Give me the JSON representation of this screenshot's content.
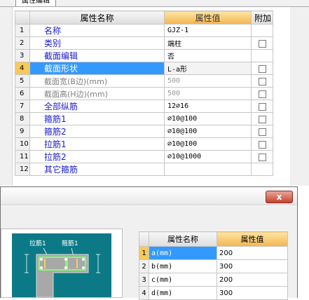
{
  "panel": {
    "tab_label": "属性编辑",
    "headers": {
      "name": "属性名称",
      "value": "属性值",
      "extra": "附加"
    },
    "rows": [
      {
        "num": "1",
        "name": "名称",
        "value": "GJZ-1",
        "checkbox": false,
        "dim": false,
        "selected": false
      },
      {
        "num": "2",
        "name": "类别",
        "value": "端柱",
        "checkbox": true,
        "dim": false,
        "selected": false
      },
      {
        "num": "3",
        "name": "截面编辑",
        "value": "否",
        "checkbox": false,
        "dim": false,
        "selected": false
      },
      {
        "num": "4",
        "name": "截面形状",
        "value": "L-a形",
        "checkbox": true,
        "dim": false,
        "selected": true
      },
      {
        "num": "5",
        "name": "截面宽(B边)(mm)",
        "value": "500",
        "checkbox": true,
        "dim": true,
        "selected": false
      },
      {
        "num": "6",
        "name": "截面高(H边)(mm)",
        "value": "500",
        "checkbox": true,
        "dim": true,
        "selected": false
      },
      {
        "num": "7",
        "name": "全部纵筋",
        "value": "12⌀16",
        "checkbox": true,
        "dim": false,
        "selected": false
      },
      {
        "num": "8",
        "name": "箍筋1",
        "value": "⌀10@100",
        "checkbox": true,
        "dim": false,
        "selected": false
      },
      {
        "num": "9",
        "name": "箍筋2",
        "value": "⌀10@100",
        "checkbox": true,
        "dim": false,
        "selected": false
      },
      {
        "num": "10",
        "name": "拉筋1",
        "value": "⌀10@100",
        "checkbox": true,
        "dim": false,
        "selected": false
      },
      {
        "num": "11",
        "name": "拉筋2",
        "value": "⌀10@1000",
        "checkbox": true,
        "dim": false,
        "selected": false
      },
      {
        "num": "12",
        "name": "其它箍筋",
        "value": "",
        "checkbox": false,
        "dim": false,
        "selected": false
      }
    ]
  },
  "dialog": {
    "close_label": "x",
    "preview_labels": {
      "tie": "拉筋1",
      "stirrup": "箍筋1"
    },
    "headers": {
      "name": "属性名称",
      "value": "属性值"
    },
    "rows": [
      {
        "num": "1",
        "name": "a(mm)",
        "value": "200",
        "selected": true
      },
      {
        "num": "2",
        "name": "b(mm)",
        "value": "300",
        "selected": false
      },
      {
        "num": "3",
        "name": "c(mm)",
        "value": "200",
        "selected": false
      },
      {
        "num": "4",
        "name": "d(mm)",
        "value": "300",
        "selected": false
      }
    ]
  },
  "colors": {
    "selection": "#3399ff",
    "header_accent": "#f2b54d",
    "property_name": "#1b1bcc",
    "drawing_bg": "#0b7a86",
    "rebar": "#7dff6a"
  }
}
